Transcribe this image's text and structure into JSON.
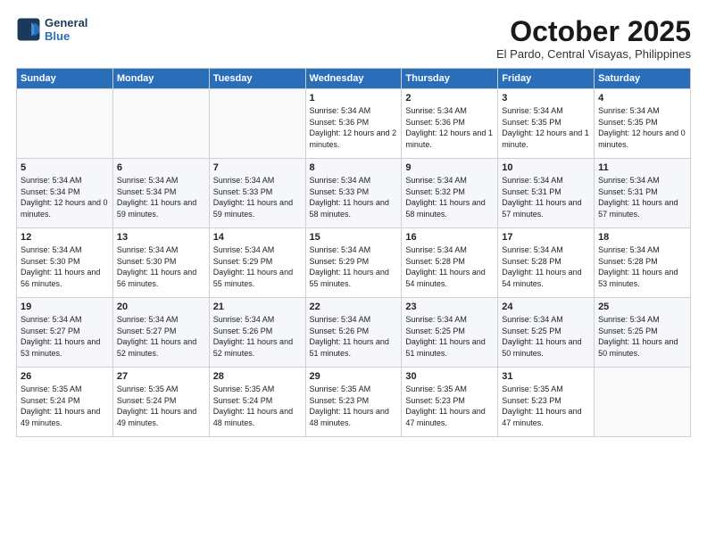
{
  "header": {
    "logo_line1": "General",
    "logo_line2": "Blue",
    "month": "October 2025",
    "location": "El Pardo, Central Visayas, Philippines"
  },
  "weekdays": [
    "Sunday",
    "Monday",
    "Tuesday",
    "Wednesday",
    "Thursday",
    "Friday",
    "Saturday"
  ],
  "weeks": [
    [
      {
        "day": "",
        "sunrise": "",
        "sunset": "",
        "daylight": ""
      },
      {
        "day": "",
        "sunrise": "",
        "sunset": "",
        "daylight": ""
      },
      {
        "day": "",
        "sunrise": "",
        "sunset": "",
        "daylight": ""
      },
      {
        "day": "1",
        "sunrise": "Sunrise: 5:34 AM",
        "sunset": "Sunset: 5:36 PM",
        "daylight": "Daylight: 12 hours and 2 minutes."
      },
      {
        "day": "2",
        "sunrise": "Sunrise: 5:34 AM",
        "sunset": "Sunset: 5:36 PM",
        "daylight": "Daylight: 12 hours and 1 minute."
      },
      {
        "day": "3",
        "sunrise": "Sunrise: 5:34 AM",
        "sunset": "Sunset: 5:35 PM",
        "daylight": "Daylight: 12 hours and 1 minute."
      },
      {
        "day": "4",
        "sunrise": "Sunrise: 5:34 AM",
        "sunset": "Sunset: 5:35 PM",
        "daylight": "Daylight: 12 hours and 0 minutes."
      }
    ],
    [
      {
        "day": "5",
        "sunrise": "Sunrise: 5:34 AM",
        "sunset": "Sunset: 5:34 PM",
        "daylight": "Daylight: 12 hours and 0 minutes."
      },
      {
        "day": "6",
        "sunrise": "Sunrise: 5:34 AM",
        "sunset": "Sunset: 5:34 PM",
        "daylight": "Daylight: 11 hours and 59 minutes."
      },
      {
        "day": "7",
        "sunrise": "Sunrise: 5:34 AM",
        "sunset": "Sunset: 5:33 PM",
        "daylight": "Daylight: 11 hours and 59 minutes."
      },
      {
        "day": "8",
        "sunrise": "Sunrise: 5:34 AM",
        "sunset": "Sunset: 5:33 PM",
        "daylight": "Daylight: 11 hours and 58 minutes."
      },
      {
        "day": "9",
        "sunrise": "Sunrise: 5:34 AM",
        "sunset": "Sunset: 5:32 PM",
        "daylight": "Daylight: 11 hours and 58 minutes."
      },
      {
        "day": "10",
        "sunrise": "Sunrise: 5:34 AM",
        "sunset": "Sunset: 5:31 PM",
        "daylight": "Daylight: 11 hours and 57 minutes."
      },
      {
        "day": "11",
        "sunrise": "Sunrise: 5:34 AM",
        "sunset": "Sunset: 5:31 PM",
        "daylight": "Daylight: 11 hours and 57 minutes."
      }
    ],
    [
      {
        "day": "12",
        "sunrise": "Sunrise: 5:34 AM",
        "sunset": "Sunset: 5:30 PM",
        "daylight": "Daylight: 11 hours and 56 minutes."
      },
      {
        "day": "13",
        "sunrise": "Sunrise: 5:34 AM",
        "sunset": "Sunset: 5:30 PM",
        "daylight": "Daylight: 11 hours and 56 minutes."
      },
      {
        "day": "14",
        "sunrise": "Sunrise: 5:34 AM",
        "sunset": "Sunset: 5:29 PM",
        "daylight": "Daylight: 11 hours and 55 minutes."
      },
      {
        "day": "15",
        "sunrise": "Sunrise: 5:34 AM",
        "sunset": "Sunset: 5:29 PM",
        "daylight": "Daylight: 11 hours and 55 minutes."
      },
      {
        "day": "16",
        "sunrise": "Sunrise: 5:34 AM",
        "sunset": "Sunset: 5:28 PM",
        "daylight": "Daylight: 11 hours and 54 minutes."
      },
      {
        "day": "17",
        "sunrise": "Sunrise: 5:34 AM",
        "sunset": "Sunset: 5:28 PM",
        "daylight": "Daylight: 11 hours and 54 minutes."
      },
      {
        "day": "18",
        "sunrise": "Sunrise: 5:34 AM",
        "sunset": "Sunset: 5:28 PM",
        "daylight": "Daylight: 11 hours and 53 minutes."
      }
    ],
    [
      {
        "day": "19",
        "sunrise": "Sunrise: 5:34 AM",
        "sunset": "Sunset: 5:27 PM",
        "daylight": "Daylight: 11 hours and 53 minutes."
      },
      {
        "day": "20",
        "sunrise": "Sunrise: 5:34 AM",
        "sunset": "Sunset: 5:27 PM",
        "daylight": "Daylight: 11 hours and 52 minutes."
      },
      {
        "day": "21",
        "sunrise": "Sunrise: 5:34 AM",
        "sunset": "Sunset: 5:26 PM",
        "daylight": "Daylight: 11 hours and 52 minutes."
      },
      {
        "day": "22",
        "sunrise": "Sunrise: 5:34 AM",
        "sunset": "Sunset: 5:26 PM",
        "daylight": "Daylight: 11 hours and 51 minutes."
      },
      {
        "day": "23",
        "sunrise": "Sunrise: 5:34 AM",
        "sunset": "Sunset: 5:25 PM",
        "daylight": "Daylight: 11 hours and 51 minutes."
      },
      {
        "day": "24",
        "sunrise": "Sunrise: 5:34 AM",
        "sunset": "Sunset: 5:25 PM",
        "daylight": "Daylight: 11 hours and 50 minutes."
      },
      {
        "day": "25",
        "sunrise": "Sunrise: 5:34 AM",
        "sunset": "Sunset: 5:25 PM",
        "daylight": "Daylight: 11 hours and 50 minutes."
      }
    ],
    [
      {
        "day": "26",
        "sunrise": "Sunrise: 5:35 AM",
        "sunset": "Sunset: 5:24 PM",
        "daylight": "Daylight: 11 hours and 49 minutes."
      },
      {
        "day": "27",
        "sunrise": "Sunrise: 5:35 AM",
        "sunset": "Sunset: 5:24 PM",
        "daylight": "Daylight: 11 hours and 49 minutes."
      },
      {
        "day": "28",
        "sunrise": "Sunrise: 5:35 AM",
        "sunset": "Sunset: 5:24 PM",
        "daylight": "Daylight: 11 hours and 48 minutes."
      },
      {
        "day": "29",
        "sunrise": "Sunrise: 5:35 AM",
        "sunset": "Sunset: 5:23 PM",
        "daylight": "Daylight: 11 hours and 48 minutes."
      },
      {
        "day": "30",
        "sunrise": "Sunrise: 5:35 AM",
        "sunset": "Sunset: 5:23 PM",
        "daylight": "Daylight: 11 hours and 47 minutes."
      },
      {
        "day": "31",
        "sunrise": "Sunrise: 5:35 AM",
        "sunset": "Sunset: 5:23 PM",
        "daylight": "Daylight: 11 hours and 47 minutes."
      },
      {
        "day": "",
        "sunrise": "",
        "sunset": "",
        "daylight": ""
      }
    ]
  ]
}
